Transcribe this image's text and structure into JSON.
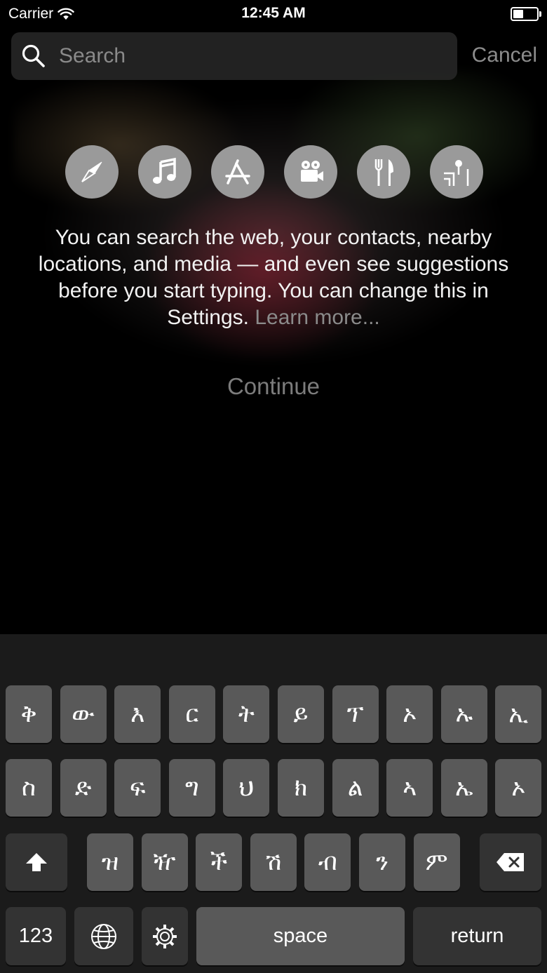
{
  "status_bar": {
    "carrier": "Carrier",
    "time": "12:45 AM",
    "battery_level": 0.45
  },
  "search": {
    "placeholder": "Search",
    "cancel_label": "Cancel"
  },
  "categories": [
    {
      "icon": "compass-icon"
    },
    {
      "icon": "music-note-icon"
    },
    {
      "icon": "app-store-icon"
    },
    {
      "icon": "movie-camera-icon"
    },
    {
      "icon": "restaurant-icon"
    },
    {
      "icon": "map-icon"
    }
  ],
  "intro": {
    "text": "You can search the web, your contacts, nearby locations, and media — and even see suggestions before you start typing. You can change this in Settings.",
    "learn_more": "Learn more..."
  },
  "continue_label": "Continue",
  "keyboard": {
    "row1": [
      "ቅ",
      "ው",
      "እ",
      "ር",
      "ት",
      "ይ",
      "ፕ",
      "ኦ",
      "ኡ",
      "ኢ"
    ],
    "row2": [
      "ስ",
      "ድ",
      "ፍ",
      "ግ",
      "ህ",
      "ክ",
      "ል",
      "ኣ",
      "ኤ",
      "ኦ"
    ],
    "row3": [
      "ዝ",
      "ዥ",
      "ች",
      "ሽ",
      "ብ",
      "ን",
      "ም"
    ],
    "numbers_label": "123",
    "space_label": "space",
    "return_label": "return"
  },
  "colors": {
    "key": "#595959",
    "key_dark": "#333333",
    "keyboard_bg": "#1b1b1b",
    "dim_text": "#8b8b8b"
  }
}
